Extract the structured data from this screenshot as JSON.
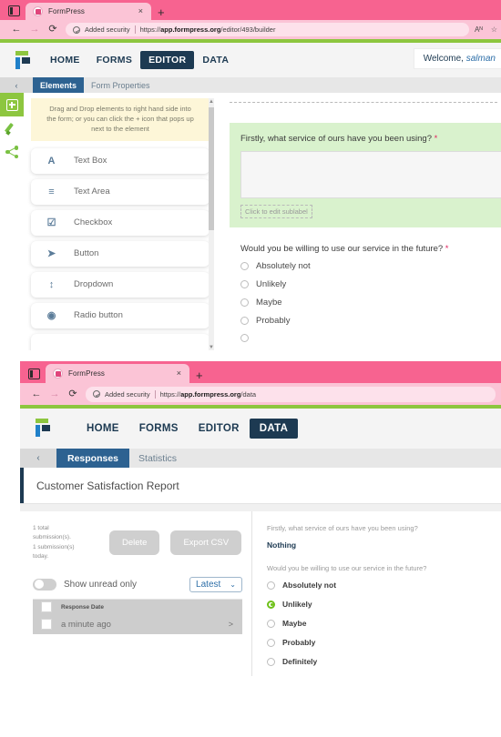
{
  "editor_window": {
    "browser": {
      "tab_title": "FormPress",
      "tab_close": "×",
      "new_tab": "+",
      "back": "←",
      "forward": "→",
      "reload": "⟳",
      "security_label": "Added security",
      "url_prefix": "https://",
      "url_host": "app.formpress.org",
      "url_path": "/editor/493/builder",
      "read_aloud": "Aᴺ",
      "favorites": "☆"
    },
    "app_nav": {
      "items": [
        {
          "label": "HOME",
          "active": false
        },
        {
          "label": "FORMS",
          "active": false
        },
        {
          "label": "EDITOR",
          "active": true
        },
        {
          "label": "DATA",
          "active": false
        }
      ],
      "welcome_prefix": "Welcome, ",
      "welcome_user": "salman"
    },
    "subtabs": {
      "collapse": "‹",
      "items": [
        {
          "label": "Elements",
          "active": true
        },
        {
          "label": "Form Properties",
          "active": false
        }
      ]
    },
    "rail": [
      {
        "name": "add-element",
        "selected": true
      },
      {
        "name": "theme-brush",
        "selected": false
      },
      {
        "name": "share",
        "selected": false
      }
    ],
    "elements_panel": {
      "hint": "Drag and Drop elements to right hand side into the form; or you can click the + icon that pops up next to the element",
      "items": [
        {
          "icon": "A",
          "label": "Text Box"
        },
        {
          "icon": "≡",
          "label": "Text Area"
        },
        {
          "icon": "☑",
          "label": "Checkbox"
        },
        {
          "icon": "➤",
          "label": "Button"
        },
        {
          "icon": "↕",
          "label": "Dropdown"
        },
        {
          "icon": "◉",
          "label": "Radio button"
        }
      ],
      "scroll_up": "▲",
      "scroll_down": "▼"
    },
    "form": {
      "question_1": {
        "label": "Firstly, what service of ours have you been using?",
        "required_mark": "*",
        "value": "",
        "sublabel": "Click to edit sublabel"
      },
      "question_2": {
        "label": "Would you be willing to use our service in the future?",
        "required_mark": "*",
        "options": [
          {
            "label": "Absolutely not",
            "selected": false
          },
          {
            "label": "Unlikely",
            "selected": false
          },
          {
            "label": "Maybe",
            "selected": false
          },
          {
            "label": "Probably",
            "selected": false
          }
        ]
      }
    }
  },
  "data_window": {
    "browser": {
      "tab_title": "FormPress",
      "tab_close": "×",
      "new_tab": "+",
      "back": "←",
      "forward": "→",
      "reload": "⟳",
      "security_label": "Added security",
      "url_prefix": "https://",
      "url_host": "app.formpress.org",
      "url_path": "/data"
    },
    "app_nav": {
      "items": [
        {
          "label": "HOME",
          "active": false
        },
        {
          "label": "FORMS",
          "active": false
        },
        {
          "label": "EDITOR",
          "active": false
        },
        {
          "label": "DATA",
          "active": true
        }
      ]
    },
    "subtabs": {
      "collapse": "‹",
      "items": [
        {
          "label": "Responses",
          "active": true
        },
        {
          "label": "Statistics",
          "active": false
        }
      ]
    },
    "report": {
      "title": "Customer Satisfaction Report"
    },
    "submissions": {
      "counts_line_1": "1 total",
      "counts_line_2": "submission(s).",
      "counts_line_3": "1 submission(s)",
      "counts_line_4": "today.",
      "delete_label": "Delete",
      "export_label": "Export CSV",
      "unread_toggle_label": "Show unread only",
      "unread_toggle_on": false,
      "sort_selected": "Latest",
      "sort_chevron": "⌄",
      "table": {
        "columns": [
          "Response Date"
        ],
        "rows": [
          {
            "date": "a minute ago",
            "chevron": ">"
          }
        ]
      }
    },
    "answers": {
      "question_1": {
        "label": "Firstly, what service of ours have you been using?",
        "value": "Nothing"
      },
      "question_2": {
        "label": "Would you be willing to use our service in the future?",
        "options": [
          {
            "label": "Absolutely not",
            "selected": false
          },
          {
            "label": "Unlikely",
            "selected": true
          },
          {
            "label": "Maybe",
            "selected": false
          },
          {
            "label": "Probably",
            "selected": false
          },
          {
            "label": "Definitely",
            "selected": false
          }
        ]
      }
    }
  },
  "colors": {
    "browser_pink": "#f76390",
    "tab_pink": "#fbc4d6",
    "accent_green": "#8dc63f",
    "navy": "#1d3a52",
    "tab_blue": "#2d6291",
    "highlight_green": "#d9f2cd",
    "required_red": "#e0245e"
  }
}
